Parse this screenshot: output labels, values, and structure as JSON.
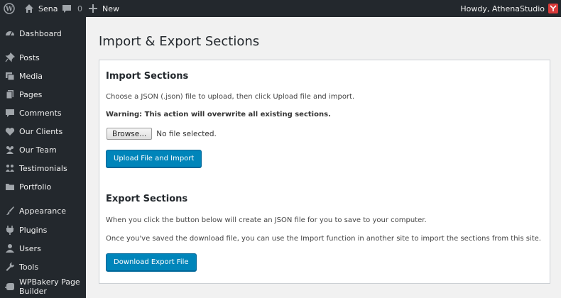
{
  "adminbar": {
    "site_name": "Sena",
    "comments_count": "0",
    "new_label": "New",
    "howdy": "Howdy, AthenaStudio"
  },
  "sidebar": {
    "items": [
      {
        "label": "Dashboard",
        "icon": "dashboard-icon"
      },
      {
        "label": "Posts",
        "icon": "pin-icon"
      },
      {
        "label": "Media",
        "icon": "media-icon"
      },
      {
        "label": "Pages",
        "icon": "pages-icon"
      },
      {
        "label": "Comments",
        "icon": "comment-icon"
      },
      {
        "label": "Our Clients",
        "icon": "heart-icon"
      },
      {
        "label": "Our Team",
        "icon": "team-icon"
      },
      {
        "label": "Testimonials",
        "icon": "testimonials-icon"
      },
      {
        "label": "Portfolio",
        "icon": "folder-icon"
      },
      {
        "label": "Appearance",
        "icon": "brush-icon"
      },
      {
        "label": "Plugins",
        "icon": "plugin-icon"
      },
      {
        "label": "Users",
        "icon": "user-icon"
      },
      {
        "label": "Tools",
        "icon": "wrench-icon"
      },
      {
        "label": "WPBakery Page Builder",
        "icon": "wpbakery-icon"
      }
    ]
  },
  "page": {
    "title": "Import & Export Sections"
  },
  "import": {
    "heading": "Import Sections",
    "instructions": "Choose a JSON (.json) file to upload, then click Upload file and import.",
    "warning": "Warning: This action will overwrite all existing sections.",
    "browse_label": "Browse...",
    "file_status": "No file selected.",
    "button_label": "Upload File and Import"
  },
  "export": {
    "heading": "Export Sections",
    "line1": "When you click the button below will create an JSON file for you to save to your computer.",
    "line2": "Once you've saved the download file, you can use the Import function in another site to import the sections from this site.",
    "button_label": "Download Export File"
  },
  "colors": {
    "adminbar_bg": "#23282d",
    "primary_button": "#0085ba",
    "avatar": "#d93a3a"
  }
}
